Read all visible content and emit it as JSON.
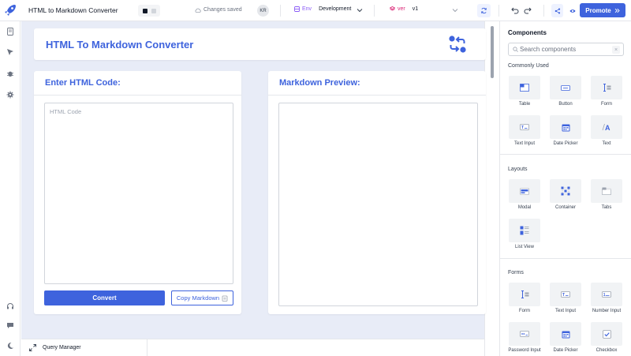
{
  "topbar": {
    "app_title": "HTML to Markdown Converter",
    "saved_text": "Changes saved",
    "avatar_initials": "KR",
    "env_label": "Env",
    "env_value": "Development",
    "version_label": "ver",
    "version_value": "v1",
    "promote_label": "Promote"
  },
  "canvas": {
    "header_title": "HTML To Markdown Converter",
    "left_panel_title": "Enter HTML Code:",
    "html_placeholder": "HTML Code",
    "convert_label": "Convert",
    "copy_label": "Copy Markdown",
    "right_panel_title": "Markdown Preview:"
  },
  "bottombar": {
    "query_manager_label": "Query Manager"
  },
  "sidebar": {
    "title": "Components",
    "search_placeholder": "Search components",
    "sections": [
      {
        "title": "Commonly Used",
        "items": [
          {
            "label": "Table",
            "icon": "table-icon"
          },
          {
            "label": "Button",
            "icon": "button-icon"
          },
          {
            "label": "Form",
            "icon": "form-icon"
          },
          {
            "label": "Text Input",
            "icon": "text-input-icon"
          },
          {
            "label": "Date Picker",
            "icon": "calendar-icon"
          },
          {
            "label": "Text",
            "icon": "text-icon"
          }
        ]
      },
      {
        "title": "Layouts",
        "items": [
          {
            "label": "Modal",
            "icon": "modal-icon"
          },
          {
            "label": "Container",
            "icon": "container-icon"
          },
          {
            "label": "Tabs",
            "icon": "tabs-icon"
          },
          {
            "label": "List View",
            "icon": "list-view-icon"
          }
        ]
      },
      {
        "title": "Forms",
        "items": [
          {
            "label": "Form",
            "icon": "form-icon"
          },
          {
            "label": "Text Input",
            "icon": "text-input-icon"
          },
          {
            "label": "Number Input",
            "icon": "number-input-icon"
          },
          {
            "label": "Password Input",
            "icon": "password-input-icon"
          },
          {
            "label": "Date Picker",
            "icon": "calendar-icon"
          },
          {
            "label": "Checkbox",
            "icon": "checkbox-icon"
          }
        ]
      }
    ]
  },
  "colors": {
    "accent": "#3e63dd",
    "canvas_bg": "#e8ecf7",
    "env_accent": "#8b5cf6",
    "version_accent": "#db2777"
  }
}
